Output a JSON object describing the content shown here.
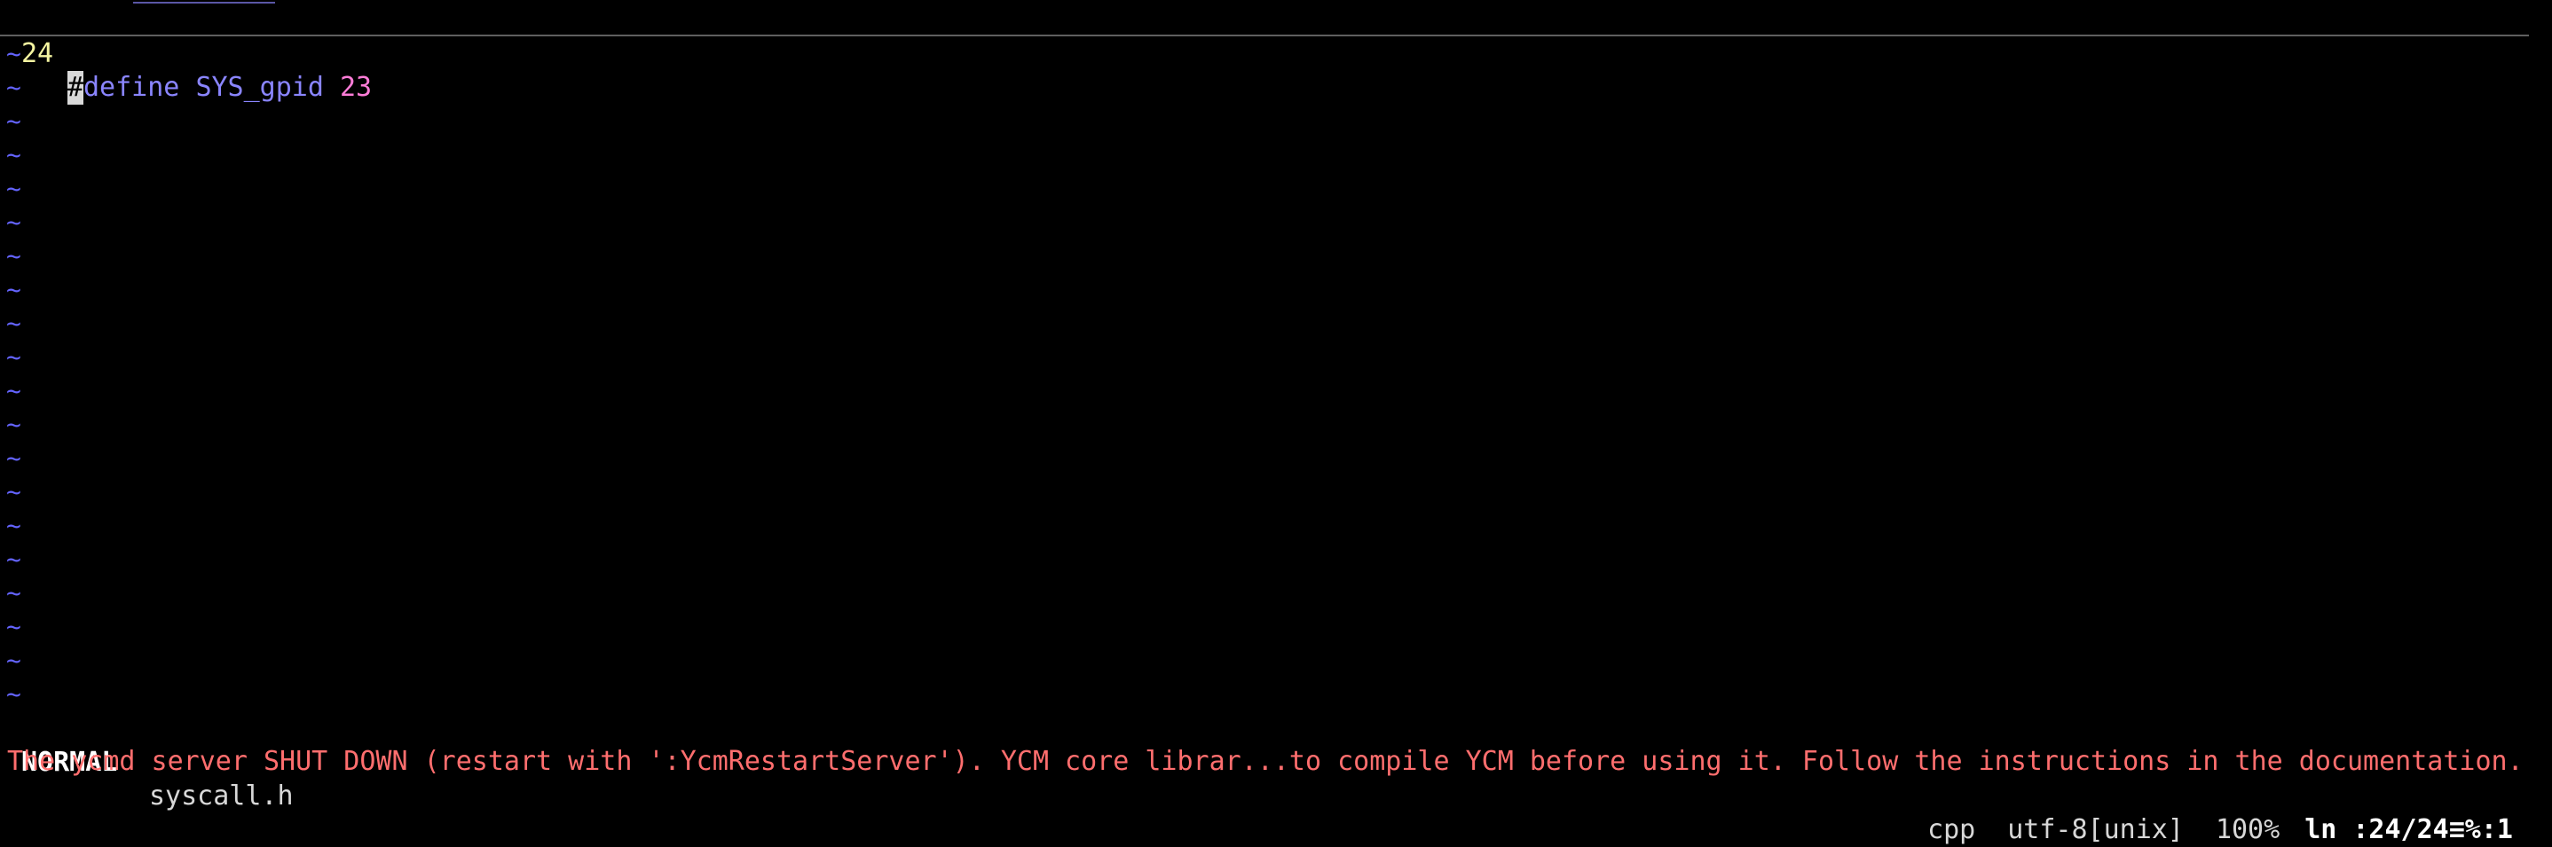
{
  "editor": {
    "line_number": "24",
    "cursor_char": "#",
    "keyword": "define",
    "identifier": "SYS_gpid",
    "value": "23",
    "tilde": "~"
  },
  "statusline": {
    "mode": "NORMAL",
    "filename": "syscall.h",
    "filetype": "cpp",
    "encoding": "utf-8[unix]",
    "percent": "100%",
    "position": "ln :24/24≡%:1"
  },
  "message": "The ycmd server SHUT DOWN (restart with ':YcmRestartServer'). YCM core librar...to compile YCM before using it. Follow the instructions in the documentation.",
  "colors": {
    "background": "#000000",
    "line_number": "#f4f4a0",
    "keyword": "#8a85ff",
    "number": "#ff7dd8",
    "tilde": "#6464ff",
    "error": "#ff6e6e"
  }
}
